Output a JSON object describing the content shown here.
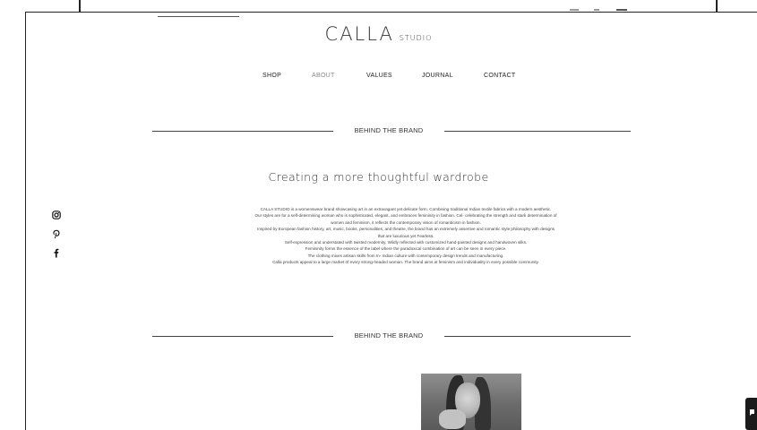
{
  "brand": {
    "name": "CALLA",
    "suffix": "STUDIO"
  },
  "nav": {
    "items": [
      {
        "label": "SHOP"
      },
      {
        "label": "ABOUT"
      },
      {
        "label": "VALUES"
      },
      {
        "label": "JOURNAL"
      },
      {
        "label": "CONTACT"
      }
    ]
  },
  "sections": {
    "first_heading": "BEHIND THE BRAND",
    "second_heading": "BEHIND THE BRAND"
  },
  "headline": "Creating a more thoughtful wardrobe",
  "body": {
    "lines": [
      "CALLA STUDIO is a womenswear brand showcasing art in an extravagant yet delicate form. Combining traditional Indian textile fabrics with a modern aesthetic.",
      "Our styles are for a self-determining woman who is sophisticated, elegant, and embraces femininity in fashion. Cel- celebrating the strength and stark determination of women and feminism, it reflects the contemporary vision of romanticism in fashion.",
      "Inspired by European fashion history, art, music, books, personalities, and theatre, the brand has an extremely assertive and romantic style philosophy with designs that are luxurious yet Fearless.",
      "Self-expression and understated with twisted modernity. Wildly reflected with customized hand-painted designs and handwoven silks.",
      "Femininity forms the essence of the label where the paradoxical combination of art can be seen in every piece.",
      "The clothing mixes artisan skills from In- Indian culture with contemporary design trends and manufacturing.",
      "Calla products appeal to a large market of every strong-headed woman. The brand aims at feminism and individuality in every possible community."
    ]
  },
  "social": [
    "instagram-icon",
    "pinterest-icon",
    "facebook-icon"
  ],
  "colors": {
    "text": "#333333",
    "rule": "#444444",
    "chat": "#1b1b1b"
  }
}
